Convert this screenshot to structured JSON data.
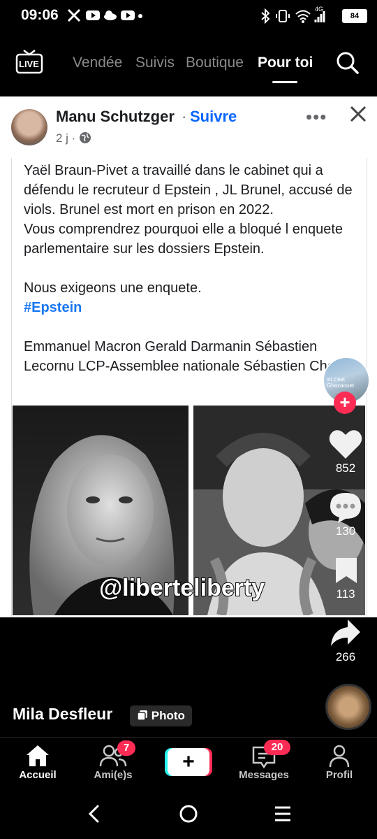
{
  "status_bar": {
    "time": "09:06",
    "battery": "84",
    "network": "4G"
  },
  "top_nav": {
    "live_label": "LIVE",
    "tabs": [
      "Vendée",
      "Suivis",
      "Boutique",
      "Pour toi"
    ],
    "active_tab": "Pour toi"
  },
  "post": {
    "author": "Manu Schutzger",
    "separator": "·",
    "follow_label": "Suivre",
    "meta": "2 j ·",
    "body": "Yaël Braun-Pivet  a travaillé dans le cabinet qui a défendu le recruteur d Epstein , JL Brunel, accusé de viols. Brunel est mort en prison en 2022.\nVous comprendrez  pourquoi elle a bloqué l enquete parlementaire sur les dossiers Epstein.\n\nNous exigeons une enquete.",
    "hashtag": "#Epstein",
    "mentions": "Emmanuel Macron  Gerald Darmanin  Sébastien Lecornu LCP-Assemblee nationale Sébastien Chenu",
    "watermark": "@liberteliberty"
  },
  "side_actions": {
    "creator_avatar_text": "ici c'est Ghazaouet",
    "likes": "852",
    "comments": "130",
    "bookmarks": "113",
    "shares": "266"
  },
  "video_info": {
    "username": "Mila Desfleur",
    "badge": "Photo"
  },
  "bottom_nav": {
    "items": [
      "Accueil",
      "Ami(e)s",
      "",
      "Messages",
      "Profil"
    ],
    "friends_badge": "7",
    "messages_badge": "20"
  },
  "colors": {
    "accent_red": "#fe2c55",
    "accent_cyan": "#25f4ee",
    "fb_blue": "#0866ff"
  }
}
